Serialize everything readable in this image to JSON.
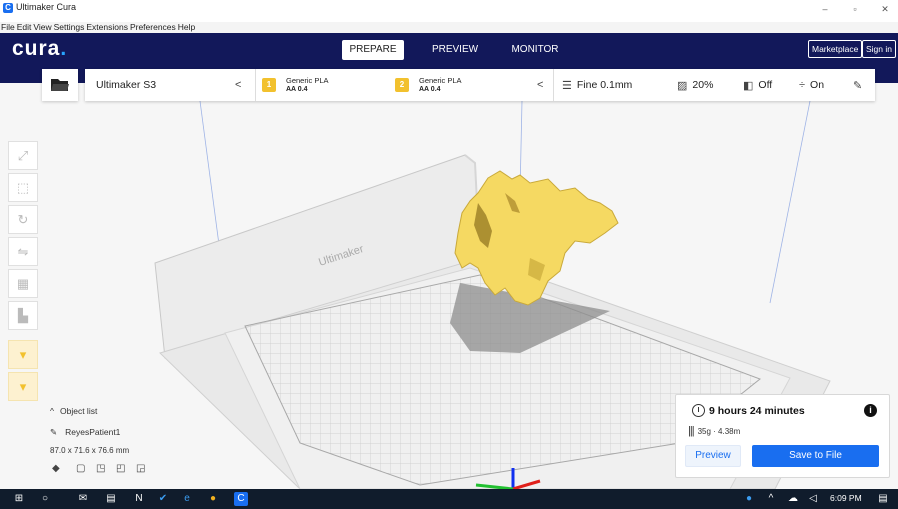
{
  "window": {
    "title": "Ultimaker Cura",
    "minimize": "–",
    "maximize": "▫",
    "close": "✕"
  },
  "menu": [
    "File",
    "Edit",
    "View",
    "Settings",
    "Extensions",
    "Preferences",
    "Help"
  ],
  "header": {
    "logo": "cura",
    "logo_dot": ".",
    "stages": [
      "PREPARE",
      "PREVIEW",
      "MONITOR"
    ],
    "active_stage": "PREPARE",
    "marketplace": "Marketplace",
    "sign_in": "Sign in"
  },
  "toolbar": {
    "printer": "Ultimaker S3",
    "extruders": [
      {
        "number": "1",
        "material": "Generic PLA",
        "core": "AA 0.4"
      },
      {
        "number": "2",
        "material": "Generic PLA",
        "core": "AA 0.4"
      }
    ],
    "profile": "Fine 0.1mm",
    "infill": "20%",
    "support": "Off",
    "adhesion": "On"
  },
  "build_plate": {
    "brand": "Ultimaker"
  },
  "object_list": {
    "header": "Object list",
    "object_name": "ReyesPatient1",
    "dimensions": "87.0 x 71.6 x 76.6 mm"
  },
  "print_info": {
    "time": "9 hours 24 minutes",
    "material": "35g · 4.38m",
    "preview_button": "Preview",
    "save_button": "Save to File"
  },
  "taskbar": {
    "time": "6:09 PM"
  },
  "colors": {
    "header_bg": "#12185a",
    "accent_blue": "#196ef0",
    "model_yellow": "#f5d962",
    "material_badge": "#f2c12e",
    "taskbar_bg": "#101c2c"
  }
}
